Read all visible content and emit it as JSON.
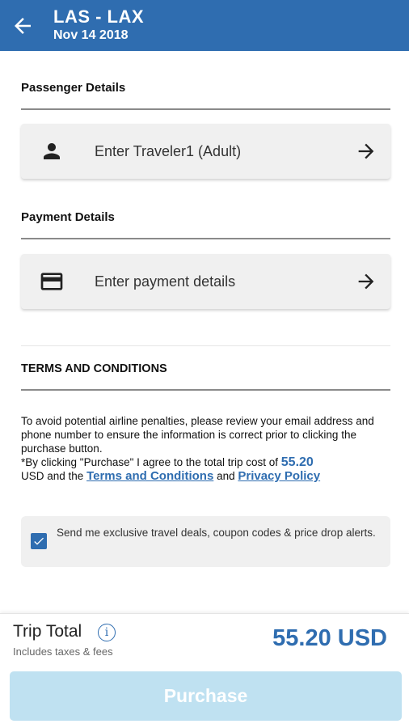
{
  "header": {
    "route": "LAS - LAX",
    "date": "Nov 14 2018",
    "back_icon": "arrow-left-icon"
  },
  "passenger": {
    "section_title": "Passenger Details",
    "card_label": "Enter Traveler1 (Adult)",
    "icon": "person-icon"
  },
  "payment": {
    "section_title": "Payment Details",
    "card_label": "Enter payment details",
    "icon": "credit-card-icon"
  },
  "terms": {
    "section_title": "TERMS AND CONDITIONS",
    "paragraph1": "To avoid potential airline penalties, please review your email address and phone number to ensure the information is correct prior to clicking the purchase button.",
    "paragraph2_prefix": "*By clicking \"Purchase\" I agree to the total trip cost of",
    "price": "55.20",
    "currency_and": "USD and the",
    "terms_link": "Terms and Conditions",
    "and": "and",
    "privacy_link": "Privacy Policy"
  },
  "optin": {
    "checked": true,
    "label": "Send me exclusive travel deals, coupon codes & price drop alerts."
  },
  "footer": {
    "trip_total_label": "Trip Total",
    "info_symbol": "i",
    "includes_label": "Includes taxes & fees",
    "total_amount": "55.20 USD",
    "purchase_label": "Purchase"
  },
  "colors": {
    "brand": "#2f6db0",
    "purchase_disabled": "#bfe1f1"
  }
}
